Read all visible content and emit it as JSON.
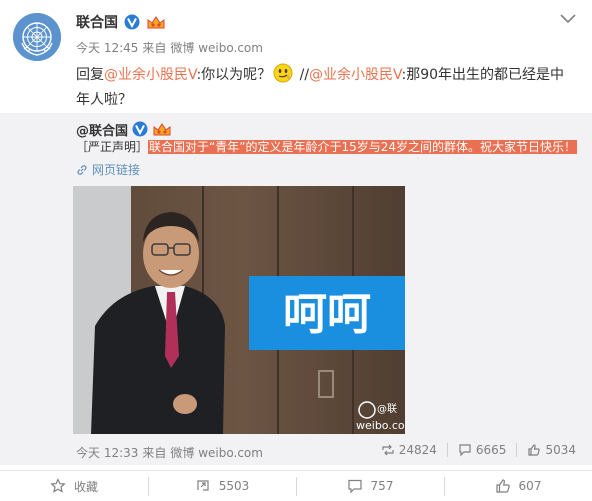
{
  "post": {
    "author": "联合国",
    "time": "今天 12:45",
    "via": "来自",
    "source": "微博 weibo.com",
    "text": {
      "reply_prefix": "回复",
      "mention1": "@业余小股民V",
      "part1": ":你以为呢？",
      "sep": " //",
      "mention2": "@业余小股民V",
      "part2": ":那90年出生的都已经是中年人啦？"
    }
  },
  "repost": {
    "author": "@联合国",
    "text_prefix": "［严正声明］",
    "text_highlight": "联合国对于“青年”的定义是年龄介于15岁与24岁之间的群体。祝大家节日快乐！",
    "link_label": "网页链接",
    "image": {
      "caption": "呵呵",
      "watermark_top": "@联",
      "watermark_bottom": "weibo.com"
    },
    "time": "今天 12:33",
    "via": "来自",
    "source": "微博 weibo.com",
    "stats": {
      "reposts": "24824",
      "comments": "6665",
      "likes": "5034"
    }
  },
  "actions": {
    "favorite": "收藏",
    "repost": "5503",
    "comment": "757",
    "like": "607"
  },
  "colors": {
    "link": "#eb7350",
    "highlight_bg": "#e97052",
    "caption_bg": "#1a8fe0",
    "verified": "#2a7bd6"
  },
  "icons": {
    "avatar": "un-emblem-icon",
    "verified": "verified-v-icon",
    "vip": "vip-crown-icon",
    "emoji": "smirk-emoji-icon",
    "menu": "chevron-down-icon",
    "link": "link-icon",
    "repost": "repost-icon",
    "comment": "comment-icon",
    "like": "thumbs-up-icon",
    "favorite": "star-icon"
  }
}
